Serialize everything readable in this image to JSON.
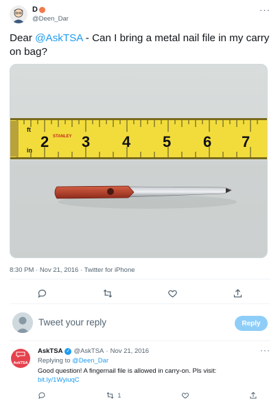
{
  "tweet": {
    "author_name": "D",
    "author_emoji": "peach",
    "author_handle": "@Deen_Dar",
    "text_before": "Dear ",
    "mention": "@AskTSA",
    "text_after": " - Can I bring a metal nail file in my carry on bag?",
    "meta": "8:30 PM · Nov 21, 2016 · Twitter for iPhone",
    "media": {
      "ruler_numbers": [
        "2",
        "3",
        "4",
        "5",
        "6",
        "7"
      ],
      "ruler_brand": "STANLEY",
      "ruler_unit_ft": "ft",
      "ruler_unit_in": "in"
    },
    "icons": {
      "reply": "reply-icon",
      "retweet": "retweet-icon",
      "like": "heart-icon",
      "share": "share-icon",
      "more": "more-icon"
    }
  },
  "compose": {
    "placeholder": "Tweet your reply",
    "button_label": "Reply"
  },
  "reply": {
    "avatar_label": "AskTSA",
    "name": "AskTSA",
    "handle": "@AskTSA",
    "separator": "·",
    "date": "Nov 21, 2016",
    "replying_to_prefix": "Replying to",
    "replying_to_handle": "@Deen_Dar",
    "text": "Good question! A fingernail file is allowed in carry-on. Pls visit:",
    "link": "bit.ly/1WyiuqC",
    "retweet_count": "1"
  },
  "colors": {
    "accent": "#1d9bf0",
    "secondary_text": "#536471",
    "tsa_red": "#e6424d",
    "ruler_yellow": "#f2dc3c"
  }
}
